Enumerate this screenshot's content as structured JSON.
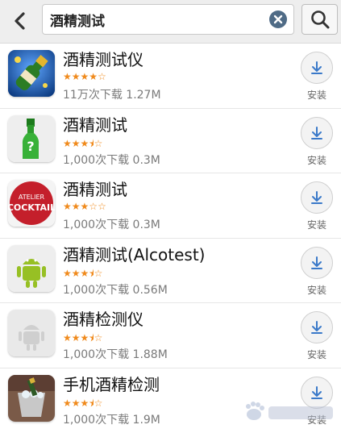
{
  "search": {
    "query": "酒精测试"
  },
  "colors": {
    "star": "#f08a1c",
    "install_arrow": "#3a79c9",
    "clear_button": "#4f6b86"
  },
  "apps": [
    {
      "name": "酒精测试仪",
      "rating": 4,
      "rating_max": 5,
      "downloads": "11万次下载",
      "size": "1.27M",
      "install_label": "安装",
      "icon": "champagne-bottle-icon"
    },
    {
      "name": "酒精测试",
      "rating": 3.5,
      "rating_max": 5,
      "downloads": "1,000次下载",
      "size": "0.3M",
      "install_label": "安装",
      "icon": "green-bottle-icon"
    },
    {
      "name": "酒精测试",
      "rating": 3,
      "rating_max": 5,
      "downloads": "1,000次下载",
      "size": "0.3M",
      "install_label": "安装",
      "icon": "atelier-cocktail-icon",
      "icon_text_top": "ATELIER",
      "icon_text_main": "COCKTAIL"
    },
    {
      "name": "酒精测试(Alcotest)",
      "rating": 3.5,
      "rating_max": 5,
      "downloads": "1,000次下载",
      "size": "0.56M",
      "install_label": "安装",
      "icon": "android-robot-icon"
    },
    {
      "name": "酒精检测仪",
      "rating": 3.5,
      "rating_max": 5,
      "downloads": "1,000次下载",
      "size": "1.88M",
      "install_label": "安装",
      "icon": "android-placeholder-icon"
    },
    {
      "name": "手机酒精检测",
      "rating": 3.5,
      "rating_max": 5,
      "downloads": "1,000次下载",
      "size": "1.9M",
      "install_label": "安装",
      "icon": "ice-bucket-icon"
    }
  ]
}
